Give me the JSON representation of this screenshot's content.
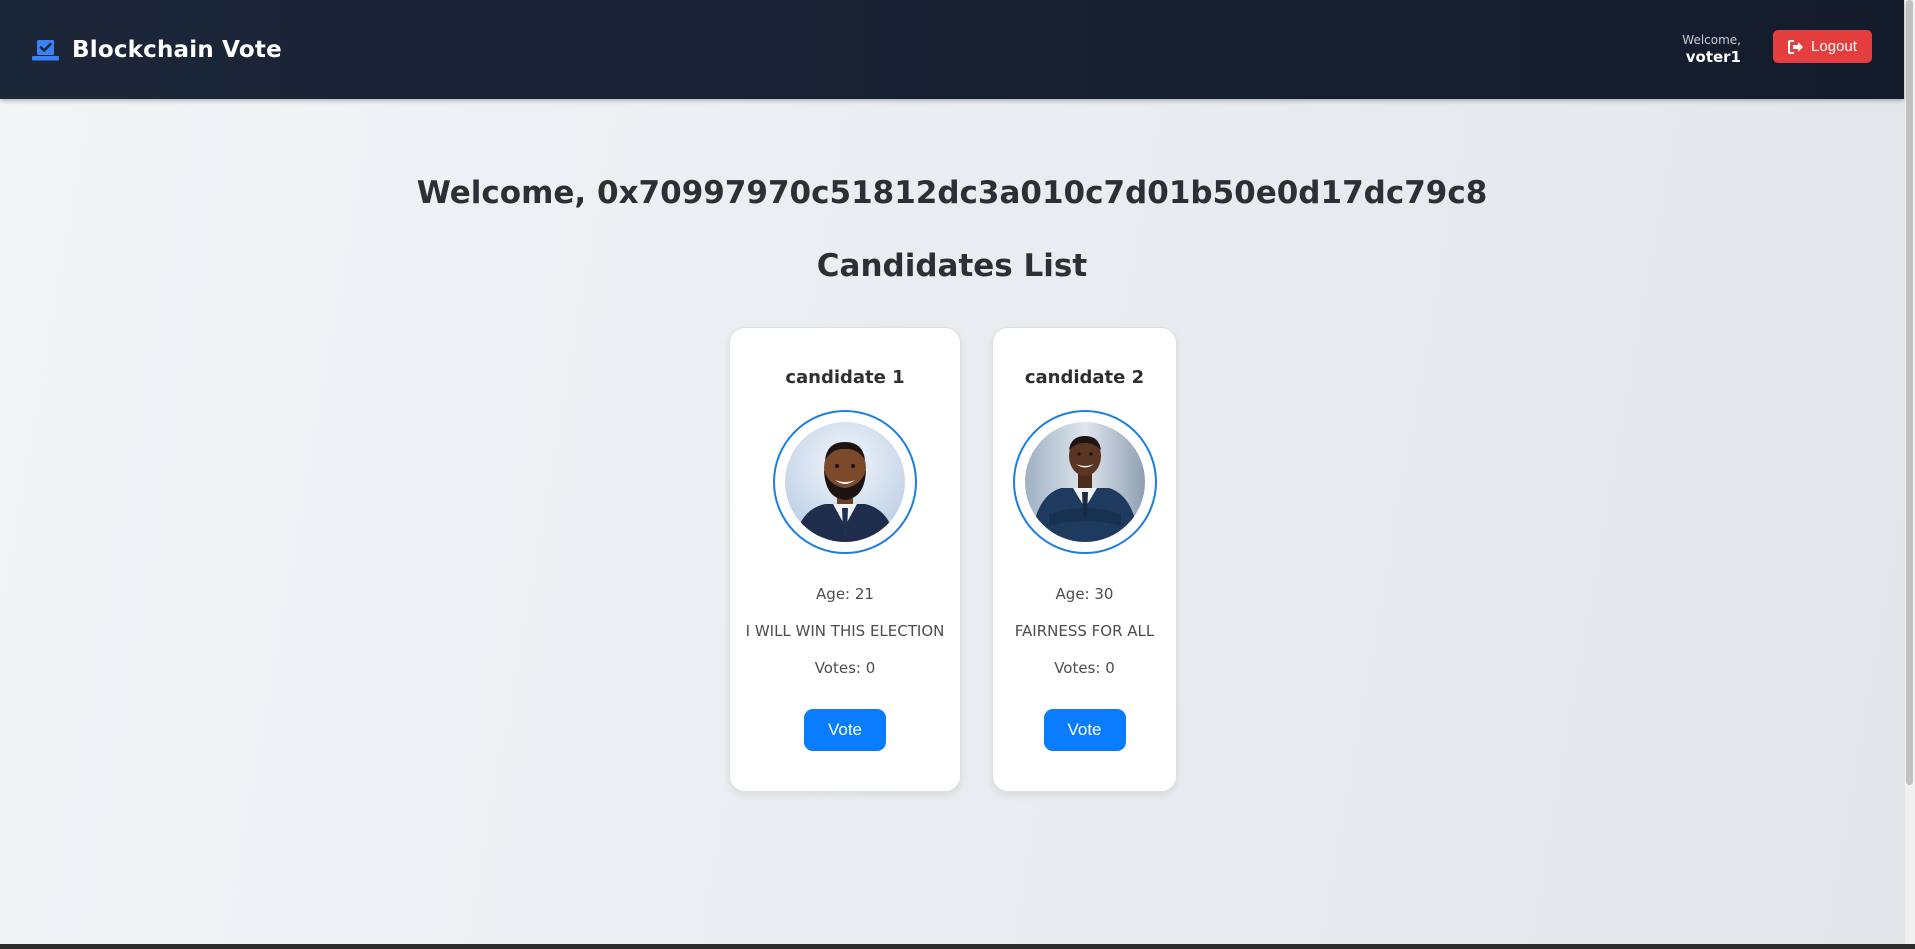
{
  "app": {
    "title": "Blockchain Vote"
  },
  "header": {
    "welcome_label": "Welcome,",
    "username": "voter1",
    "logout_label": "Logout"
  },
  "main": {
    "welcome_text": "Welcome, 0x70997970c51812dc3a010c7d01b50e0d17dc79c8",
    "section_title": "Candidates List"
  },
  "candidates": [
    {
      "name": "candidate 1",
      "age": "Age: 21",
      "slogan": "I WILL WIN THIS ELECTION",
      "votes": "Votes: 0",
      "vote_label": "Vote"
    },
    {
      "name": "candidate 2",
      "age": "Age: 30",
      "slogan": "FAIRNESS FOR ALL",
      "votes": "Votes: 0",
      "vote_label": "Vote"
    }
  ],
  "icons": {
    "brand": "ballot-box-check-icon",
    "logout": "sign-out-icon"
  },
  "colors": {
    "navbar": "#1c2639",
    "logout_button": "#e53e3e",
    "vote_button": "#0a7cff",
    "avatar_ring": "#1a7ee6",
    "brand_icon": "#3b82f6"
  }
}
